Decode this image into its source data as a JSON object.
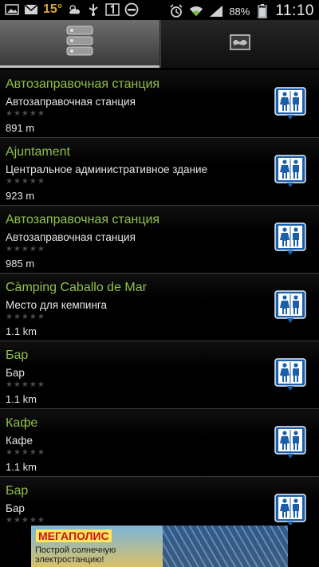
{
  "status_bar": {
    "temperature": "15°",
    "battery": "88%",
    "time": "11:10",
    "notification_icons": [
      "image-icon",
      "mail-icon",
      "weather-icon",
      "usb-icon",
      "one-icon",
      "minus-circle-icon"
    ],
    "system_icons": [
      "alarm-icon",
      "wifi-icon",
      "signal-icon",
      "battery-icon"
    ]
  },
  "tabs": [
    {
      "icon": "list-icon",
      "selected": true
    },
    {
      "icon": "map-icon",
      "selected": false
    }
  ],
  "places": [
    {
      "title": "Автозаправочная станция",
      "category": "Автозаправочная станция",
      "distance": "891 m",
      "rating": 0,
      "icon": "restroom-icon"
    },
    {
      "title": "Ajuntament",
      "category": "Центральное административное здание",
      "distance": "923 m",
      "rating": 0,
      "icon": "restroom-icon"
    },
    {
      "title": "Автозаправочная станция",
      "category": "Автозаправочная станция",
      "distance": "985 m",
      "rating": 0,
      "icon": "restroom-icon"
    },
    {
      "title": "Càmping Caballo de Mar",
      "category": "Место для кемпинга",
      "distance": "1.1 km",
      "rating": 0,
      "icon": "restroom-icon"
    },
    {
      "title": "Бар",
      "category": "Бар",
      "distance": "1.1 km",
      "rating": 0,
      "icon": "restroom-icon"
    },
    {
      "title": "Кафе",
      "category": "Кафе",
      "distance": "1.1 km",
      "rating": 0,
      "icon": "restroom-icon"
    },
    {
      "title": "Бар",
      "category": "Бар",
      "distance": "",
      "rating": 0,
      "icon": "restroom-icon"
    }
  ],
  "rating_stars": "★★★★★",
  "ad": {
    "brand": "МЕГАПОЛИС",
    "text": "Построй солнечную электростанцию!"
  },
  "colors": {
    "title": "#8fc04a",
    "icon_blue": "#1c5fa8"
  }
}
